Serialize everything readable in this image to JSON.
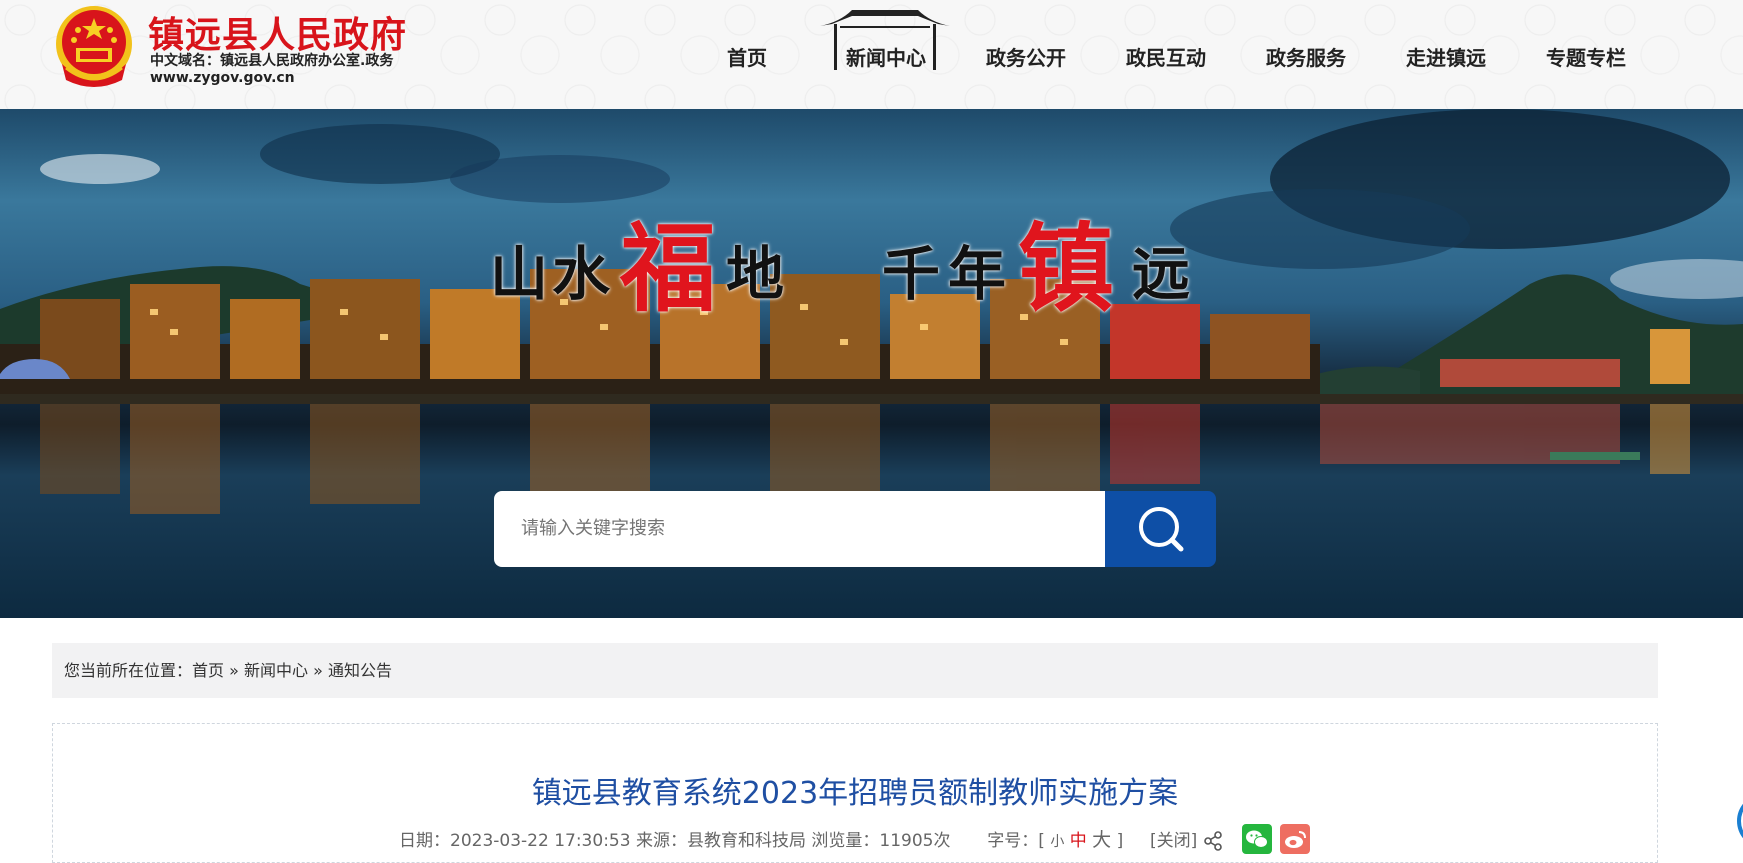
{
  "header": {
    "site_title": "镇远县人民政府",
    "site_domain": "中文域名：镇远县人民政府办公室.政务",
    "site_url": "www.zygov.gov.cn"
  },
  "nav": {
    "items": [
      {
        "label": "首页"
      },
      {
        "label": "新闻中心",
        "active": true
      },
      {
        "label": "政务公开"
      },
      {
        "label": "政民互动"
      },
      {
        "label": "政务服务"
      },
      {
        "label": "走进镇远"
      },
      {
        "label": "专题专栏"
      }
    ]
  },
  "banner": {
    "slogan_chars": [
      "山",
      "水",
      "福",
      "地",
      "千",
      "年",
      "镇",
      "远"
    ]
  },
  "search": {
    "placeholder": "请输入关键字搜索",
    "button_icon": "search-icon"
  },
  "breadcrumb": {
    "prefix": "您当前所在位置：",
    "home": "首页",
    "sep1": "»",
    "section": "新闻中心",
    "sep2": "»",
    "current": "通知公告"
  },
  "article": {
    "title": "镇远县教育系统2023年招聘员额制教师实施方案",
    "date_label": "日期：",
    "date": "2023-03-22 17:30:53",
    "source_label": "来源：",
    "source": "县教育和科技局",
    "views_label": "浏览量：",
    "views": "11905次",
    "fontsize_label": "字号：",
    "bracket_open": "[",
    "fs_small": "小",
    "fs_medium": "中",
    "fs_large": "大",
    "bracket_close": "]",
    "close": "[关闭]",
    "share_icons": [
      "share-icon",
      "wechat-icon",
      "weibo-icon"
    ]
  },
  "colors": {
    "title_red": "#d8141b",
    "nav_text": "#222222",
    "search_button": "#0e4fa6",
    "article_title": "#1f4fa3",
    "wechat": "#25b63e",
    "weibo": "#ee6e61"
  }
}
